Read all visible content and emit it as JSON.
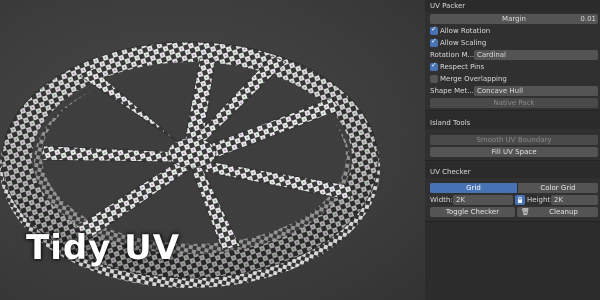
{
  "overlay_title": "Tidy UV",
  "accent_color": "#4772b3",
  "uv_packer": {
    "header": "UV Packer",
    "margin_label": "Margin",
    "margin_value": "0.01",
    "allow_rotation": "Allow Rotation",
    "allow_scaling": "Allow Scaling",
    "rotation_label": "Rotation M...",
    "rotation_value": "Cardinal",
    "respect_pins": "Respect Pins",
    "merge_overlapping": "Merge Overlapping",
    "shape_label": "Shape Met...",
    "shape_value": "Concave Hull",
    "native_pack": "Native Pack"
  },
  "island_tools": {
    "header": "Island Tools",
    "smooth_uv_boundary": "Smooth UV Boundary",
    "fill_uv_space": "Fill UV Space"
  },
  "uv_checker": {
    "header": "UV Checker",
    "tab_grid": "Grid",
    "tab_color_grid": "Color Grid",
    "width_label": "Width:",
    "width_value": "2K",
    "height_label": "Height:",
    "height_value": "2K",
    "toggle_checker": "Toggle Checker",
    "cleanup": "Cleanup"
  }
}
